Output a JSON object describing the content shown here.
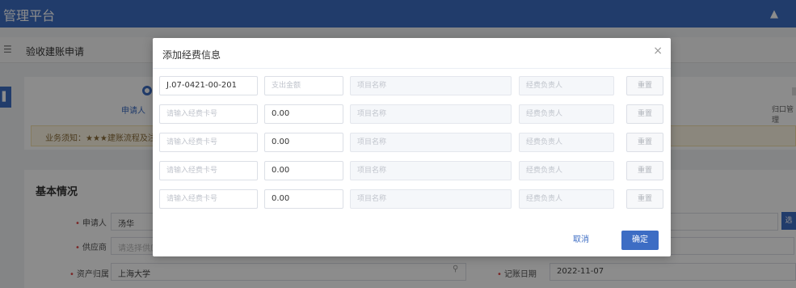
{
  "app": {
    "title": "管理平台",
    "shirt_icon": "shirt-icon"
  },
  "subbar": {
    "menu_icon": "menu-icon",
    "page_title": "验收建账申请"
  },
  "steps": {
    "first_label": "申请人",
    "right_label": "归口管理"
  },
  "notice": {
    "text": "业务须知：★★★建账流程及注意事项"
  },
  "basic": {
    "heading": "基本情况",
    "applicant_label": "申请人",
    "applicant_value": "汤华",
    "supplier_label": "供应商",
    "supplier_placeholder": "请选择供应商",
    "owner_label": "资产归属",
    "owner_value": "上海大学",
    "date_label": "记账日期",
    "date_value": "2022-11-07",
    "side_button": "选"
  },
  "modal": {
    "title": "添加经费信息",
    "close": "×",
    "cancel_label": "取消",
    "ok_label": "确定",
    "rows": [
      {
        "card": "J.07-0421-00-201",
        "card_placeholder": "请输入经费卡号",
        "amount": "",
        "amount_placeholder": "支出金额",
        "project_placeholder": "项目名称",
        "manager_placeholder": "经费负责人",
        "reset_label": "重置"
      },
      {
        "card": "",
        "card_placeholder": "请输入经费卡号",
        "amount": "0.00",
        "amount_placeholder": "支出金额",
        "project_placeholder": "项目名称",
        "manager_placeholder": "经费负责人",
        "reset_label": "重置"
      },
      {
        "card": "",
        "card_placeholder": "请输入经费卡号",
        "amount": "0.00",
        "amount_placeholder": "支出金额",
        "project_placeholder": "项目名称",
        "manager_placeholder": "经费负责人",
        "reset_label": "重置"
      },
      {
        "card": "",
        "card_placeholder": "请输入经费卡号",
        "amount": "0.00",
        "amount_placeholder": "支出金额",
        "project_placeholder": "项目名称",
        "manager_placeholder": "经费负责人",
        "reset_label": "重置"
      },
      {
        "card": "",
        "card_placeholder": "请输入经费卡号",
        "amount": "0.00",
        "amount_placeholder": "支出金额",
        "project_placeholder": "项目名称",
        "manager_placeholder": "经费负责人",
        "reset_label": "重置"
      }
    ]
  },
  "colors": {
    "primary": "#3d6dc4",
    "required": "#e04848",
    "notice_bg": "#fdf6e3"
  }
}
